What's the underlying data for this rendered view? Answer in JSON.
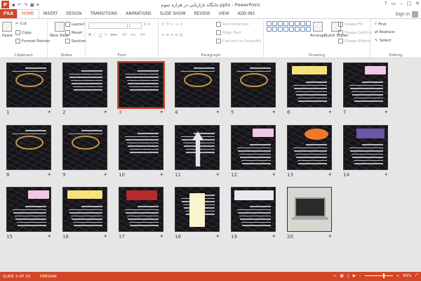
{
  "window": {
    "title": "جایگاه بازاریابی در هزاره سوم.pptx - PowerPoint",
    "app_icon": "P",
    "controls": [
      "?",
      "▭",
      "–",
      "□",
      "✕"
    ]
  },
  "tabs": {
    "file": "FILE",
    "items": [
      "HOME",
      "INSERT",
      "DESIGN",
      "TRANSITIONS",
      "ANIMATIONS",
      "SLIDE SHOW",
      "REVIEW",
      "VIEW",
      "ADD-INS"
    ],
    "active": "HOME",
    "sign_in": "Sign in"
  },
  "ribbon": {
    "clipboard": {
      "label": "Clipboard",
      "paste": "Paste",
      "cut": "Cut",
      "copy": "Copy",
      "format_painter": "Format Painter"
    },
    "slides": {
      "label": "Slides",
      "new_slide": "New Slide",
      "layout": "Layout",
      "reset": "Reset",
      "section": "Section"
    },
    "font": {
      "label": "Font"
    },
    "paragraph": {
      "label": "Paragraph",
      "text_direction": "Text Direction",
      "align_text": "Align Text",
      "smartart": "Convert to SmartArt"
    },
    "drawing": {
      "label": "Drawing",
      "arrange": "Arrange",
      "quick_styles": "Quick Styles",
      "shape_fill": "Shape Fill",
      "shape_outline": "Shape Outline",
      "shape_effects": "Shape Effects"
    },
    "editing": {
      "label": "Editing",
      "find": "Find",
      "replace": "Replace",
      "select": "Select"
    }
  },
  "slides": [
    {
      "num": "1",
      "kind": "marketing"
    },
    {
      "num": "2",
      "kind": "text"
    },
    {
      "num": "3",
      "kind": "text",
      "selected": true
    },
    {
      "num": "4",
      "kind": "marketing"
    },
    {
      "num": "5",
      "kind": "marketing"
    },
    {
      "num": "6",
      "kind": "yellowbox"
    },
    {
      "num": "7",
      "kind": "pinkbox"
    },
    {
      "num": "8",
      "kind": "marketing"
    },
    {
      "num": "9",
      "kind": "marketing"
    },
    {
      "num": "10",
      "kind": "text"
    },
    {
      "num": "11",
      "kind": "arrow"
    },
    {
      "num": "12",
      "kind": "pinkbox"
    },
    {
      "num": "13",
      "kind": "orangeburst"
    },
    {
      "num": "14",
      "kind": "bluebox"
    },
    {
      "num": "15",
      "kind": "pinkbox"
    },
    {
      "num": "16",
      "kind": "yellowbox"
    },
    {
      "num": "17",
      "kind": "redtitle"
    },
    {
      "num": "18",
      "kind": "scroll"
    },
    {
      "num": "19",
      "kind": "whitebanner"
    },
    {
      "num": "20",
      "kind": "laptop"
    }
  ],
  "star": "★",
  "status": {
    "slide": "SLIDE 3 OF 20",
    "language": "PERSIAN",
    "zoom": "60%"
  }
}
